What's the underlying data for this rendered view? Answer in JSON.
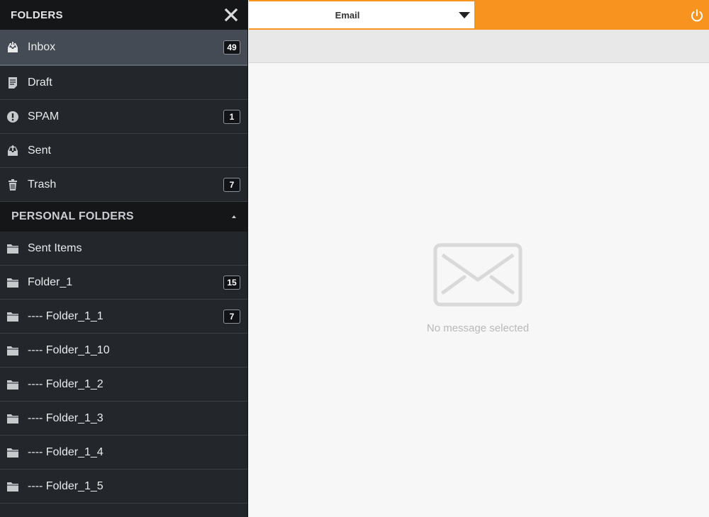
{
  "sidebar": {
    "title": "FOLDERS",
    "folders": [
      {
        "label": "Inbox",
        "count": "49",
        "icon": "inbox-icon"
      },
      {
        "label": "Draft",
        "count": "",
        "icon": "draft-icon"
      },
      {
        "label": "SPAM",
        "count": "1",
        "icon": "spam-icon"
      },
      {
        "label": "Sent",
        "count": "",
        "icon": "sent-icon"
      },
      {
        "label": "Trash",
        "count": "7",
        "icon": "trash-icon"
      }
    ],
    "personal_title": "PERSONAL FOLDERS",
    "personal": [
      {
        "label": "Sent Items",
        "count": ""
      },
      {
        "label": "Folder_1",
        "count": "15"
      },
      {
        "label": "---- Folder_1_1",
        "count": "7"
      },
      {
        "label": "---- Folder_1_10",
        "count": ""
      },
      {
        "label": "---- Folder_1_2",
        "count": ""
      },
      {
        "label": "---- Folder_1_3",
        "count": ""
      },
      {
        "label": "---- Folder_1_4",
        "count": ""
      },
      {
        "label": "---- Folder_1_5",
        "count": ""
      }
    ]
  },
  "topbar": {
    "account": "Email",
    "accent_color": "#f7931e"
  },
  "main": {
    "empty_text": "No message selected"
  }
}
